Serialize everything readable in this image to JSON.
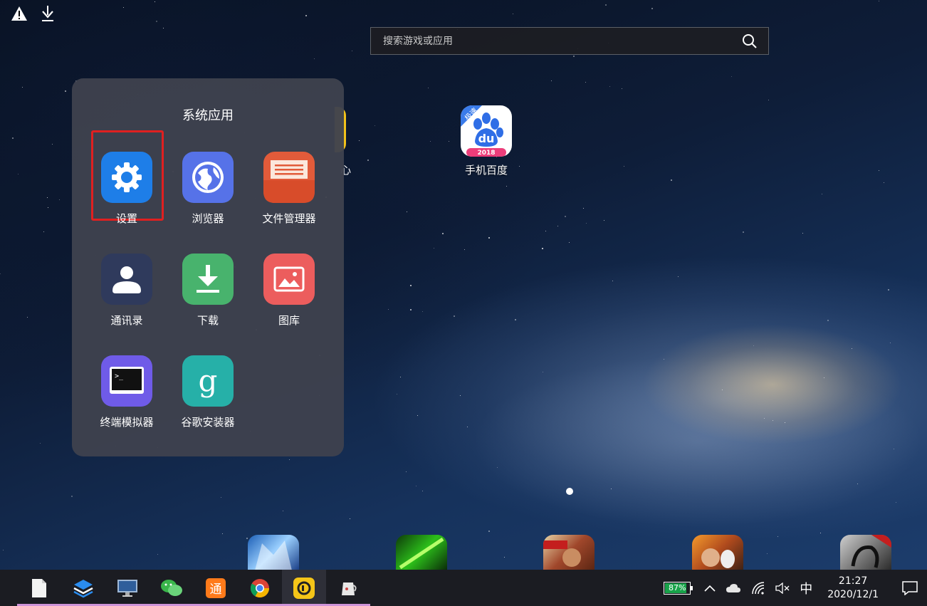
{
  "search": {
    "placeholder": "搜索游戏或应用"
  },
  "desktop": {
    "partial_label": "心",
    "baidu": {
      "label": "手机百度",
      "badge": "极速",
      "logo_text": "du",
      "year": "2018"
    }
  },
  "folder": {
    "title": "系统应用",
    "apps": [
      {
        "label": "设置",
        "icon": "gear-icon",
        "color": "#1e7ee8"
      },
      {
        "label": "浏览器",
        "icon": "globe-icon",
        "color": "#5672e8"
      },
      {
        "label": "文件管理器",
        "icon": "folder-icon",
        "color": "#e25b3a"
      },
      {
        "label": "通讯录",
        "icon": "contact-icon",
        "color": "#2f3a5c"
      },
      {
        "label": "下载",
        "icon": "download-icon",
        "color": "#48b36d"
      },
      {
        "label": "图库",
        "icon": "image-icon",
        "color": "#ec5d5d"
      },
      {
        "label": "终端模拟器",
        "icon": "terminal-icon",
        "color": "#6f5be8",
        "prompt": ">_"
      },
      {
        "label": "谷歌安装器",
        "icon": "google-installer-icon",
        "color": "#26b0a8",
        "glyph": "g"
      }
    ]
  },
  "taskbar": {
    "tong_glyph": "通",
    "battery": {
      "percent_text": "87%",
      "level": 0.87
    },
    "ime": "中",
    "time": "21:27",
    "date": "2020/12/1"
  }
}
